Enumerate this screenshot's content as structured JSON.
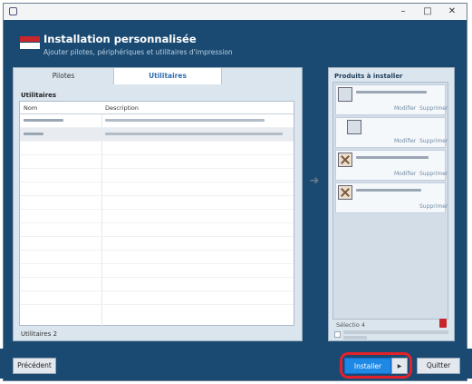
{
  "window": {
    "title": "",
    "minimize_glyph": "–",
    "maximize_glyph": "□",
    "close_glyph": "✕"
  },
  "header": {
    "title": "Installation personnalisée",
    "subtitle": "Ajouter pilotes, périphériques et utilitaires d'impression"
  },
  "tabs": [
    {
      "label": "Pilotes"
    },
    {
      "label": "Utilitaires"
    }
  ],
  "utilities": {
    "section_label": "Utilitaires",
    "columns": [
      "Nom",
      "Description"
    ],
    "count_label": "Utilitaires 2"
  },
  "arrow_glyph": "➜",
  "products": {
    "title": "Produits à installer",
    "items": [
      {
        "modify": "Modifier",
        "delete": "Supprimer"
      },
      {
        "modify": "Modifier",
        "delete": "Supprimer"
      },
      {
        "modify": "Modifier",
        "delete": "Supprimer"
      },
      {
        "delete": "Supprimer"
      }
    ],
    "selected_label": "Sélectio 4"
  },
  "footer": {
    "previous": "Précédent",
    "install": "Installer",
    "install_dropdown_glyph": "▶",
    "quit": "Quitter"
  },
  "colors": {
    "window_bg": "#1a4a72",
    "accent": "#1e88e5",
    "highlight": "#e3212b",
    "brand_red": "#c9262c"
  }
}
